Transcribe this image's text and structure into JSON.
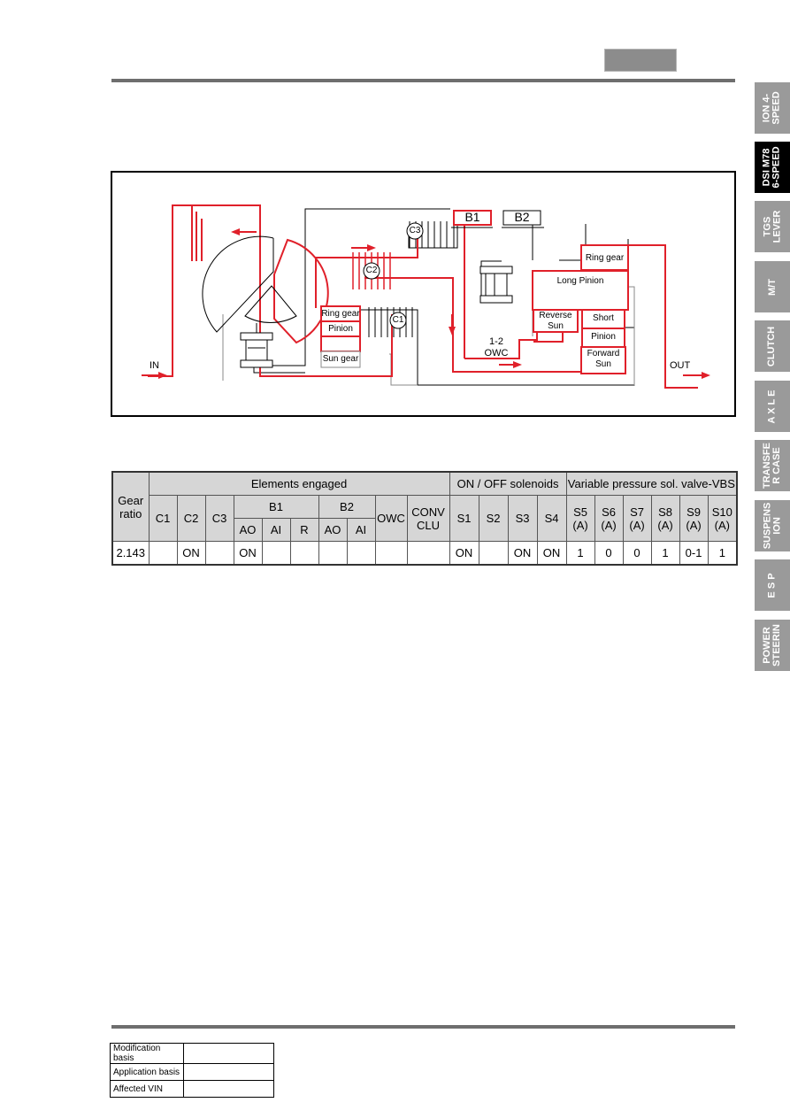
{
  "header": {
    "section_box": ""
  },
  "side_tabs": [
    {
      "label": "ION 4-\nSPEED",
      "active": false
    },
    {
      "label": "DSI M78\n6-SPEED",
      "active": true
    },
    {
      "label": "TGS\nLEVER",
      "active": false
    },
    {
      "label": "M/T",
      "active": false
    },
    {
      "label": "CLUTCH",
      "active": false
    },
    {
      "label": "A X L E",
      "active": false
    },
    {
      "label": "TRANSFE\nR CASE",
      "active": false
    },
    {
      "label": "SUSPENS\nION",
      "active": false
    },
    {
      "label": "E S P",
      "active": false
    },
    {
      "label": "POWER\nSTEERIN",
      "active": false
    }
  ],
  "diagram": {
    "input_label": "IN",
    "output_label": "OUT",
    "front_ring_gear": "Ring gear",
    "front_pinion": "Pinion",
    "front_sun_gear": "Sun gear",
    "clutch_c1": "C1",
    "clutch_c2": "C2",
    "clutch_c3": "C3",
    "brake_b1": "B1",
    "brake_b2": "B2",
    "owc_line1": "1-2",
    "owc_line2": "OWC",
    "rear_ring_gear": "Ring gear",
    "long_pinion": "Long Pinion",
    "reverse_sun_1": "Reverse",
    "reverse_sun_2": "Sun",
    "short_pinion_1": "Short",
    "short_pinion_2": "Pinion",
    "forward_sun_1": "Forward",
    "forward_sun_2": "Sun",
    "colors": {
      "power_flow": "#e0202a",
      "structure": "#000000",
      "neutral": "#888888"
    }
  },
  "table": {
    "gear_ratio_header_1": "Gear",
    "gear_ratio_header_2": "ratio",
    "group_elements": "Elements  engaged",
    "group_onoff": "ON / OFF  solenoids",
    "group_vbs": "Variable pressure sol.  valve-VBS",
    "col_c1": "C1",
    "col_c2": "C2",
    "col_c3": "C3",
    "col_b1": "B1",
    "col_b2": "B2",
    "col_owc": "OWC",
    "col_conv_1": "CONV",
    "col_conv_2": "CLU",
    "sub_b1_ao": "AO",
    "sub_b1_ai": "AI",
    "sub_b1_r": "R",
    "sub_b2_ao": "AO",
    "sub_b2_ai": "AI",
    "col_s1": "S1",
    "col_s2": "S2",
    "col_s3": "S3",
    "col_s4": "S4",
    "vbs_cols": [
      {
        "name": "S5",
        "unit": "(A)"
      },
      {
        "name": "S6",
        "unit": "(A)"
      },
      {
        "name": "S7",
        "unit": "(A)"
      },
      {
        "name": "S8",
        "unit": "(A)"
      },
      {
        "name": "S9",
        "unit": "(A)"
      },
      {
        "name": "S10",
        "unit": "(A)"
      }
    ],
    "row": {
      "gear_ratio": "2.143",
      "c1": "",
      "c2": "ON",
      "c3": "",
      "b1_ao": "ON",
      "b1_ai": "",
      "b1_r": "",
      "b2_ao": "",
      "b2_ai": "",
      "owc": "",
      "conv_clu": "",
      "s1": "ON",
      "s2": "",
      "s3": "ON",
      "s4": "ON",
      "s5": "1",
      "s6": "0",
      "s7": "0",
      "s8": "1",
      "s9": "0-1",
      "s10": "1"
    }
  },
  "modification_table": [
    {
      "label": "Modification basis",
      "value": ""
    },
    {
      "label": "Application basis",
      "value": ""
    },
    {
      "label": "Affected VIN",
      "value": ""
    }
  ]
}
